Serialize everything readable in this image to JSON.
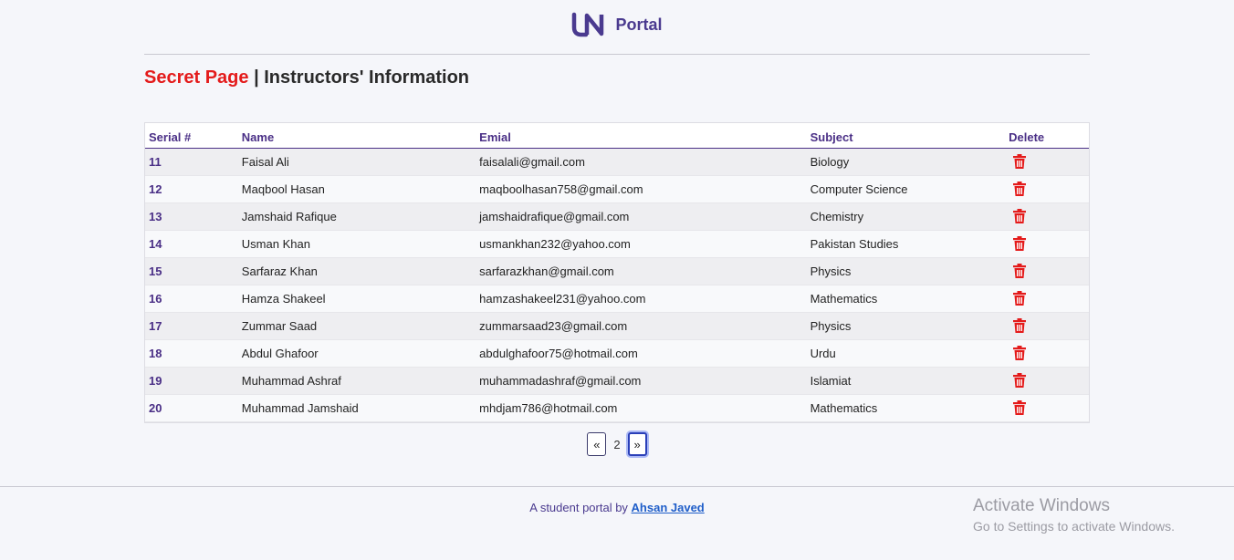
{
  "brand": {
    "text": "Portal"
  },
  "page_title": {
    "secret": "Secret Page",
    "separator": "|",
    "rest": "Instructors' Information"
  },
  "table": {
    "columns": [
      "Serial #",
      "Name",
      "Emial",
      "Subject",
      "Delete"
    ],
    "rows": [
      {
        "serial": "11",
        "name": "Faisal Ali",
        "email": "faisalali@gmail.com",
        "subject": "Biology"
      },
      {
        "serial": "12",
        "name": "Maqbool Hasan",
        "email": "maqboolhasan758@gmail.com",
        "subject": "Computer Science"
      },
      {
        "serial": "13",
        "name": "Jamshaid Rafique",
        "email": "jamshaidrafique@gmail.com",
        "subject": "Chemistry"
      },
      {
        "serial": "14",
        "name": "Usman Khan",
        "email": "usmankhan232@yahoo.com",
        "subject": "Pakistan Studies"
      },
      {
        "serial": "15",
        "name": "Sarfaraz Khan",
        "email": "sarfarazkhan@gmail.com",
        "subject": "Physics"
      },
      {
        "serial": "16",
        "name": "Hamza Shakeel",
        "email": "hamzashakeel231@yahoo.com",
        "subject": "Mathematics"
      },
      {
        "serial": "17",
        "name": "Zummar Saad",
        "email": "zummarsaad23@gmail.com",
        "subject": "Physics"
      },
      {
        "serial": "18",
        "name": "Abdul Ghafoor",
        "email": "abdulghafoor75@hotmail.com",
        "subject": "Urdu"
      },
      {
        "serial": "19",
        "name": "Muhammad Ashraf",
        "email": "muhammadashraf@gmail.com",
        "subject": "Islamiat"
      },
      {
        "serial": "20",
        "name": "Muhammad Jamshaid",
        "email": "mhdjam786@hotmail.com",
        "subject": "Mathematics"
      }
    ],
    "delete_icon": "trash-icon"
  },
  "pagination": {
    "prev": "«",
    "current": "2",
    "next": "»"
  },
  "footer": {
    "text": "A student portal by ",
    "author": "Ahsan Javed"
  },
  "watermark": {
    "line1": "Activate Windows",
    "line2": "Go to Settings to activate Windows."
  },
  "colors": {
    "accent": "#4a2f86",
    "danger": "#e41b1b",
    "link": "#1f5ec9"
  }
}
